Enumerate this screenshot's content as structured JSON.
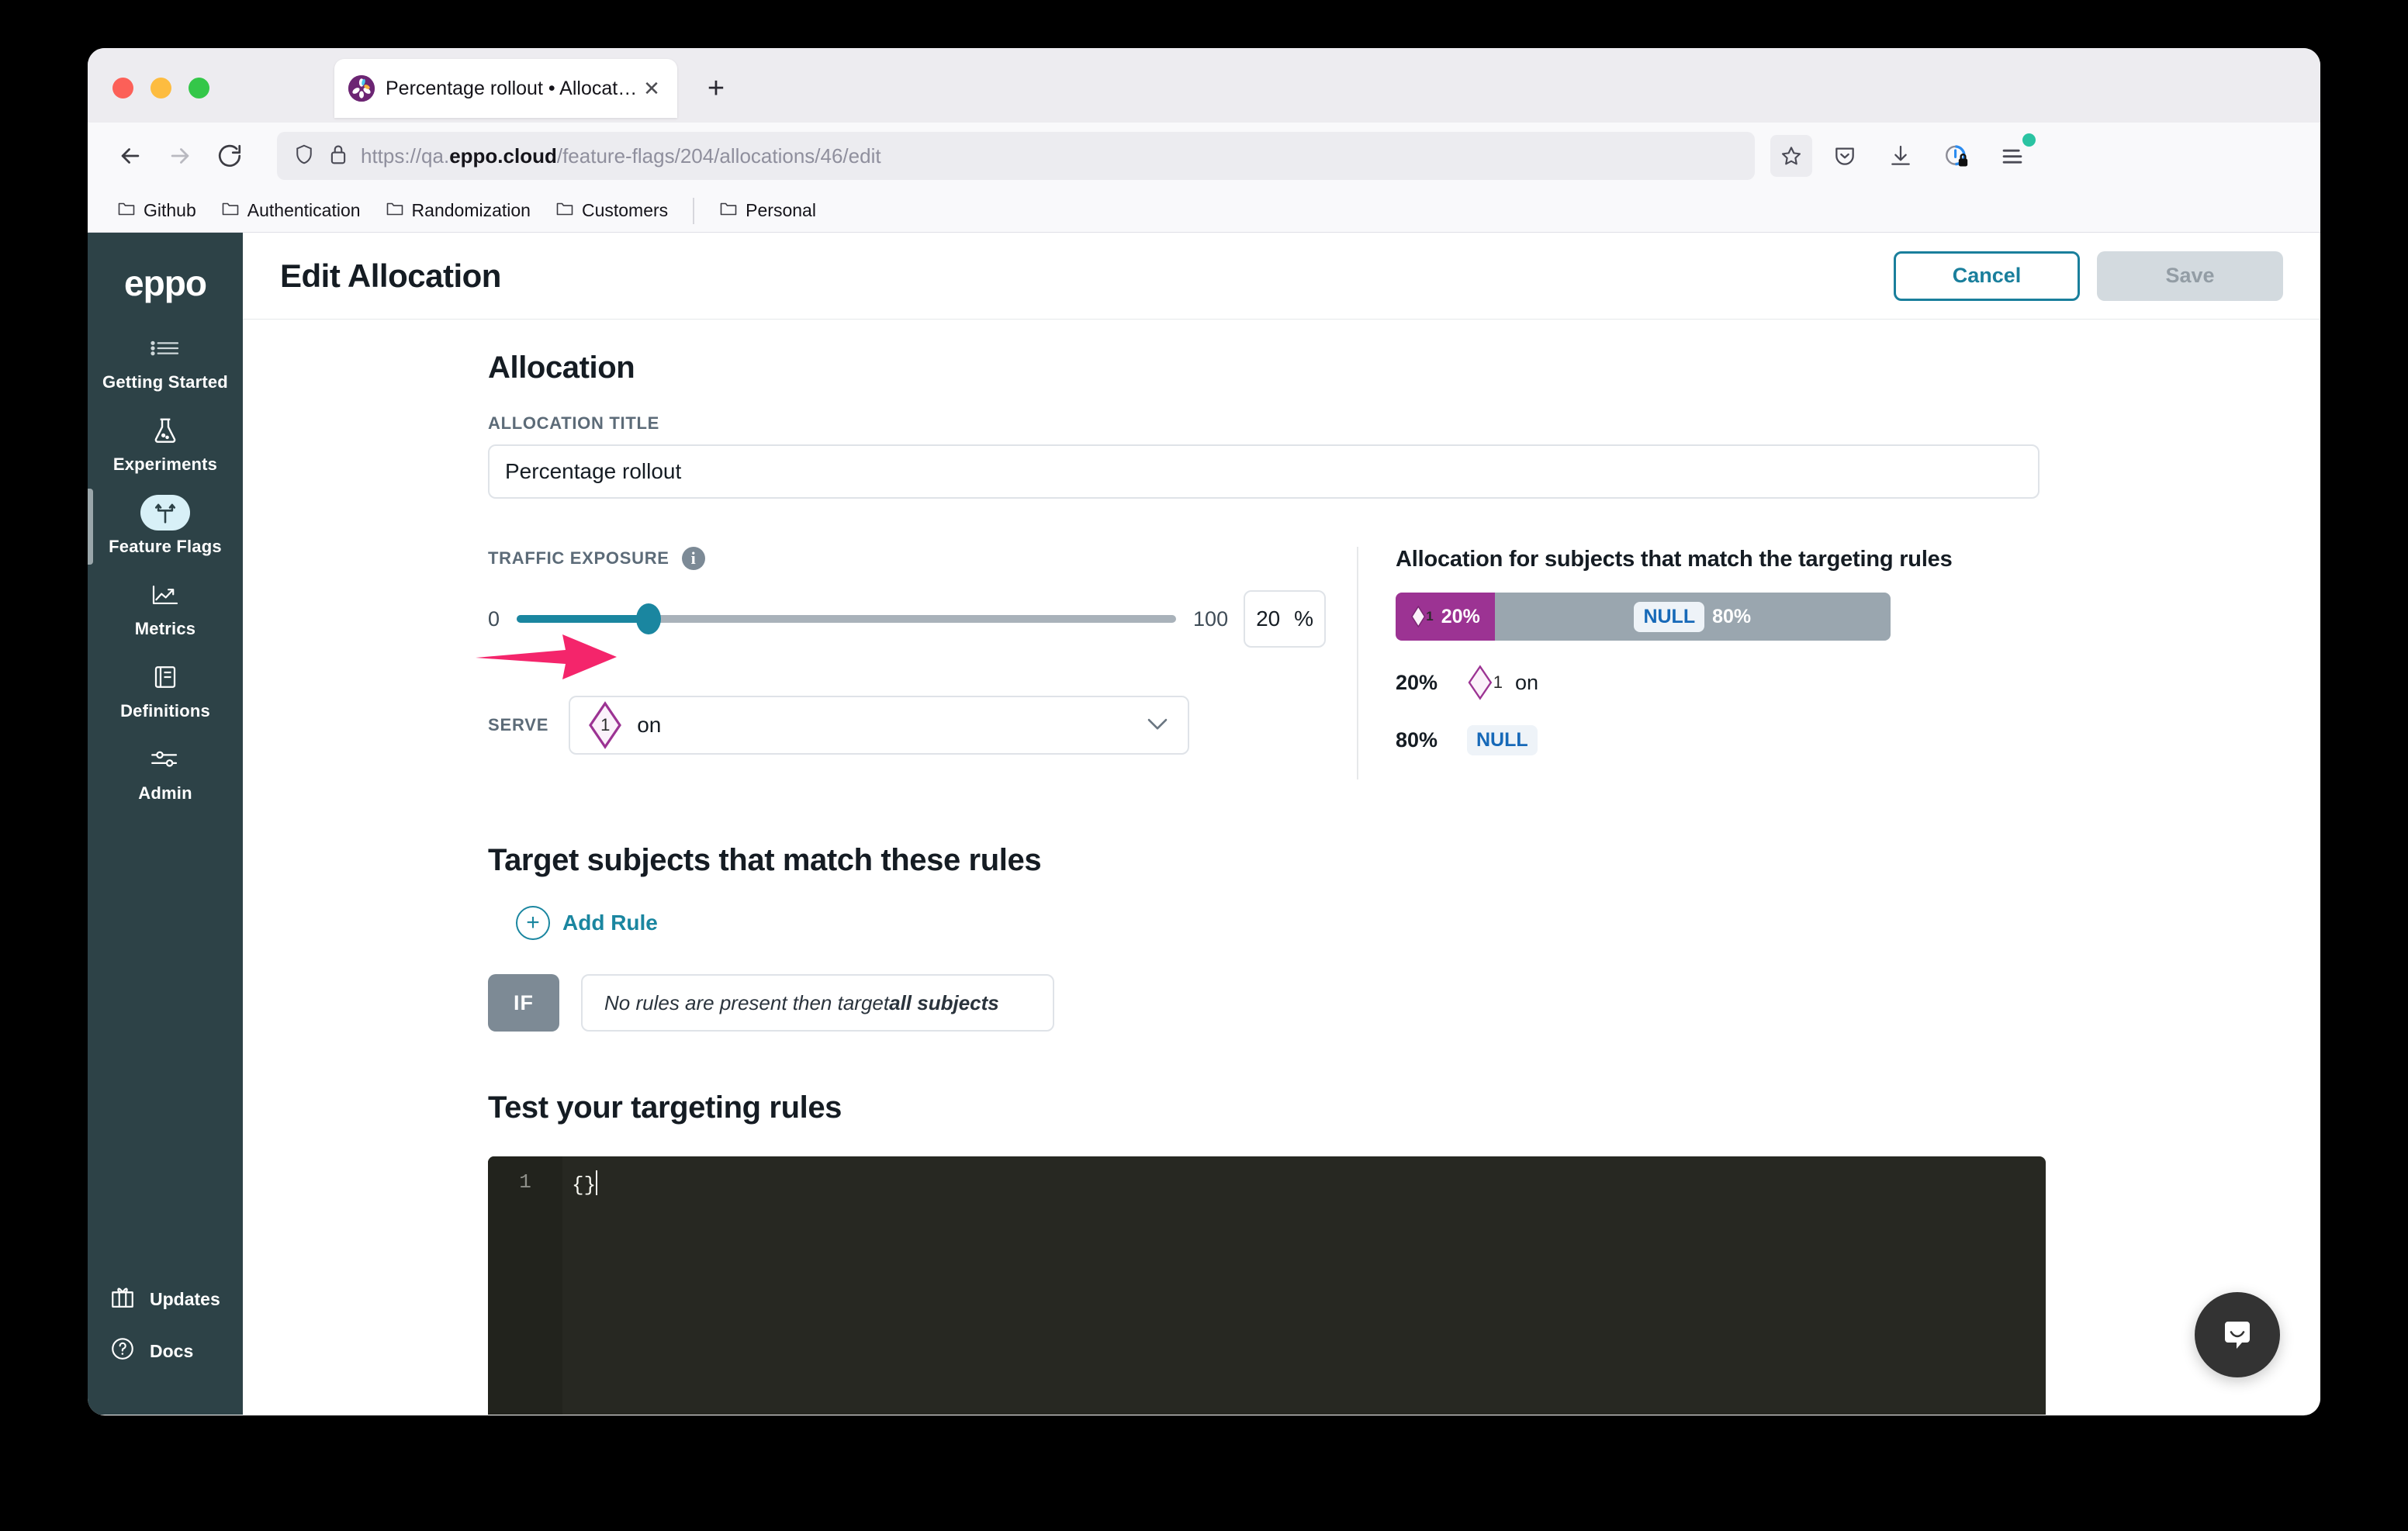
{
  "browser": {
    "tab": {
      "title": "Percentage rollout • Allocation",
      "close_label": "✕",
      "favicon_name": "eppo-favicon"
    },
    "new_tab_label": "+",
    "url": {
      "prefix": "https://qa.",
      "domain": "eppo.cloud",
      "path": "/feature-flags/204/allocations/46/edit",
      "full": "https://qa.eppo.cloud/feature-flags/204/allocations/46/edit"
    },
    "bookmarks": [
      {
        "label": "Github"
      },
      {
        "label": "Authentication"
      },
      {
        "label": "Randomization"
      },
      {
        "label": "Customers"
      },
      {
        "label": "Personal"
      }
    ]
  },
  "sidebar": {
    "brand": "eppo",
    "items": [
      {
        "label": "Getting Started",
        "icon": "list-icon",
        "active": false
      },
      {
        "label": "Experiments",
        "icon": "flask-icon",
        "active": false
      },
      {
        "label": "Feature Flags",
        "icon": "flag-split-icon",
        "active": true
      },
      {
        "label": "Metrics",
        "icon": "trend-up-icon",
        "active": false
      },
      {
        "label": "Definitions",
        "icon": "book-icon",
        "active": false
      },
      {
        "label": "Admin",
        "icon": "sliders-icon",
        "active": false
      }
    ],
    "bottom_items": [
      {
        "label": "Updates",
        "icon": "gift-icon"
      },
      {
        "label": "Docs",
        "icon": "question-circle-icon"
      }
    ]
  },
  "header": {
    "title": "Edit Allocation",
    "cancel_label": "Cancel",
    "save_label": "Save"
  },
  "allocation": {
    "section_title": "Allocation",
    "title_label": "ALLOCATION TITLE",
    "title_value": "Percentage rollout",
    "traffic_exposure": {
      "label": "TRAFFIC EXPOSURE",
      "info_glyph": "i",
      "min": "0",
      "max": "100",
      "value": "20",
      "percent_sign": "%",
      "fill_percent": 20
    },
    "serve": {
      "label": "SERVE",
      "variant_number": "1",
      "value": "on",
      "chevron": "chevron-down-icon"
    }
  },
  "alloc_panel": {
    "title": "Allocation for subjects that match the targeting rules",
    "bar": [
      {
        "name": "on",
        "variant_number": "1",
        "percent": "20%",
        "width": 20,
        "color": "#9c3393",
        "kind": "variant"
      },
      {
        "name": "NULL",
        "percent": "80%",
        "width": 80,
        "color": "#9aa6af",
        "kind": "null"
      }
    ],
    "legend": [
      {
        "percent": "20%",
        "variant_number": "1",
        "name": "on",
        "kind": "variant"
      },
      {
        "percent": "80%",
        "name": "NULL",
        "kind": "null"
      }
    ]
  },
  "rules": {
    "section_title": "Target subjects that match these rules",
    "add_rule_label": "Add Rule",
    "add_rule_plus": "+",
    "if_label": "IF",
    "empty_text_prefix": "No rules are present then target ",
    "empty_text_bold": "all subjects"
  },
  "test": {
    "section_title": "Test your targeting rules",
    "editor": {
      "line_number": "1",
      "code": "{}"
    }
  },
  "widgets": {
    "intercom_label": "intercom-chat-launcher"
  },
  "annotation": {
    "arrow_color": "#f4256b",
    "points_to": "TRAFFIC EXPOSURE"
  },
  "colors": {
    "sidebar_bg": "#2d4247",
    "accent_teal": "#1a86a0",
    "variant_purple": "#9c3393",
    "null_gray": "#9aa6af",
    "null_text_blue": "#1769b8",
    "editor_bg": "#272822"
  }
}
